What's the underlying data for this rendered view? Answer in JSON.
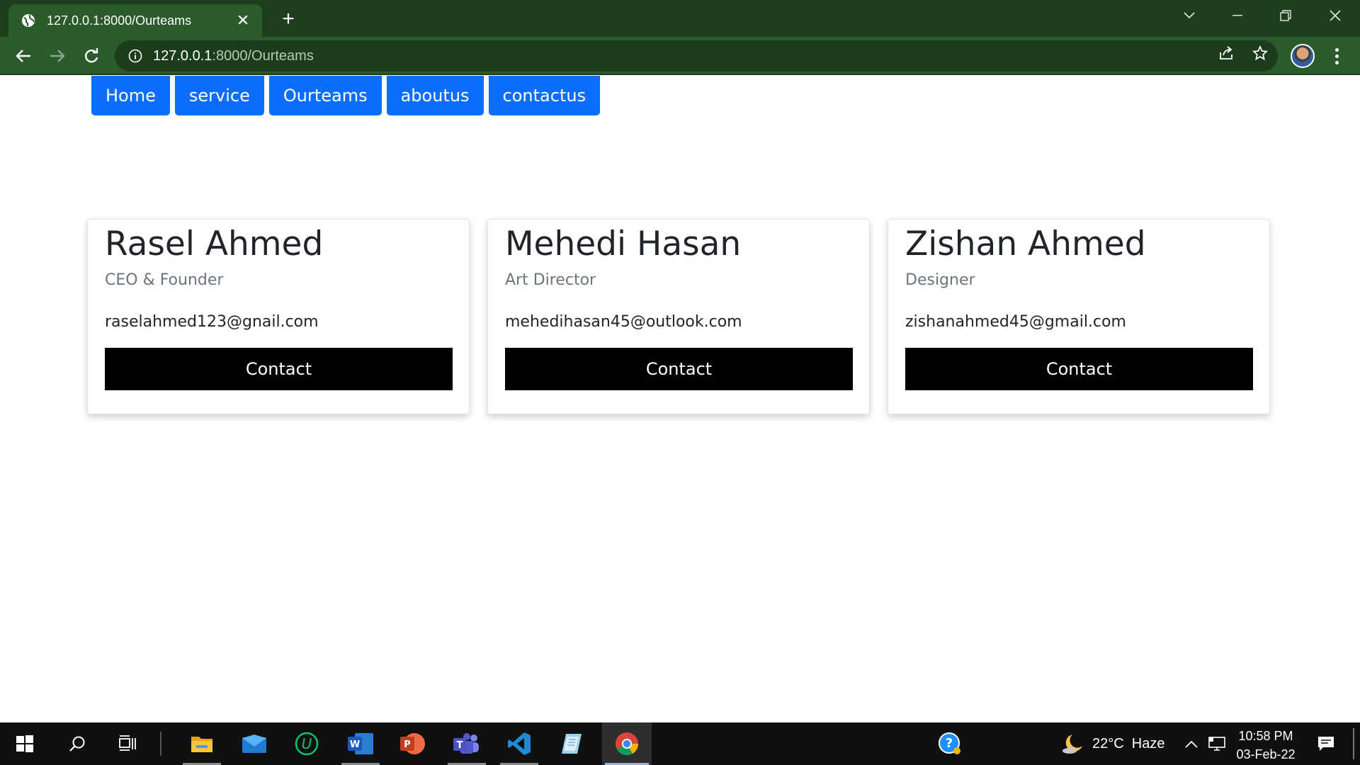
{
  "browser": {
    "tab_title": "127.0.0.1:8000/Ourteams",
    "url_host": "127.0.0.1",
    "url_path": ":8000/Ourteams",
    "theme_color": "#2b5a2b"
  },
  "nav": {
    "links": [
      "Home",
      "service",
      "Ourteams",
      "aboutus",
      "contactus"
    ],
    "color": "#0d6efd"
  },
  "team": [
    {
      "name": "Rasel Ahmed",
      "role": "CEO & Founder",
      "email": "raselahmed123@gnail.com",
      "button": "Contact"
    },
    {
      "name": "Mehedi Hasan",
      "role": "Art Director",
      "email": "mehedihasan45@outlook.com",
      "button": "Contact"
    },
    {
      "name": "Zishan Ahmed",
      "role": "Designer",
      "email": "zishanahmed45@gmail.com",
      "button": "Contact"
    }
  ],
  "taskbar": {
    "apps": [
      "windows-start-icon",
      "search-icon",
      "task-view-icon",
      "file-explorer-icon",
      "mail-icon",
      "upwork-icon",
      "word-icon",
      "powerpoint-icon",
      "teams-icon",
      "vscode-icon",
      "notepad-icon",
      "chrome-icon"
    ],
    "weather": "22°C  Haze",
    "time": "10:58 PM",
    "date": "03-Feb-22"
  }
}
